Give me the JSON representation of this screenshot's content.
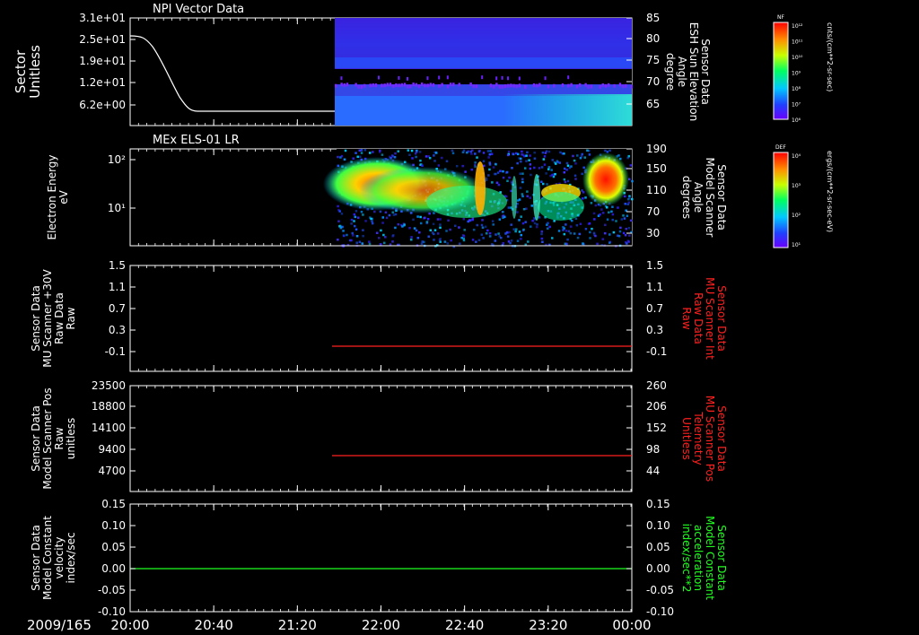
{
  "date_label": "2009/165",
  "time_ticks": [
    "20:00",
    "20:40",
    "21:20",
    "22:00",
    "22:40",
    "23:20",
    "00:00"
  ],
  "colorbars": [
    {
      "tag": "NF",
      "top_label": "10¹²",
      "tick_labels": [
        "10¹²",
        "10¹¹",
        "10¹⁰",
        "10⁹",
        "10⁸",
        "10⁷",
        "10⁶"
      ],
      "unit": "cnts/(cm**2-sr-sec)"
    },
    {
      "tag": "DEF",
      "tick_labels": [
        "10⁴",
        "10³",
        "10²",
        "10¹"
      ],
      "unit": "ergs/(cm**2-sr-sec-eV)"
    }
  ],
  "panels": [
    {
      "title": "NPI Vector Data",
      "left_label": [
        "Sector",
        "Unitless"
      ],
      "left_ticks": [
        "3.1e+01",
        "2.5e+01",
        "1.9e+01",
        "1.2e+01",
        "6.2e+00"
      ],
      "right_label": [
        "Sensor Data",
        "ESH Sun Elevation",
        "Angle",
        "degree"
      ],
      "right_ticks": [
        "85",
        "80",
        "75",
        "70",
        "65"
      ],
      "right_label_color": "#ffffff"
    },
    {
      "title": "MEx ELS-01 LR",
      "left_label": [
        "Electron Energy",
        "eV"
      ],
      "left_ticks": [
        "10²",
        "10¹"
      ],
      "right_label": [
        "Sensor Data",
        "Model Scanner",
        "Angle",
        "degrees"
      ],
      "right_ticks": [
        "190",
        "150",
        "110",
        "70",
        "30"
      ],
      "right_label_color": "#ffffff"
    },
    {
      "left_label": [
        "Sensor Data",
        "MU Scanner +30V",
        "Raw Data",
        "Raw"
      ],
      "left_ticks": [
        "1.5",
        "1.1",
        "0.7",
        "0.3",
        "-0.1"
      ],
      "right_label": [
        "Sensor Data",
        "MU Scanner Int",
        "Raw Data",
        "Raw"
      ],
      "right_ticks": [
        "1.5",
        "1.1",
        "0.7",
        "0.3",
        "-0.1"
      ],
      "right_label_color": "#ff2020"
    },
    {
      "left_label": [
        "Sensor Data",
        "Model Scanner Pos",
        "Raw",
        "unitless"
      ],
      "left_ticks": [
        "23500",
        "18800",
        "14100",
        "9400",
        "4700"
      ],
      "right_label": [
        "Sensor Data",
        "MU Scanner Pos",
        "Telemetry",
        "Unitless"
      ],
      "right_ticks": [
        "260",
        "206",
        "152",
        "98",
        "44"
      ],
      "right_label_color": "#ff2020"
    },
    {
      "left_label": [
        "Sensor Data",
        "Model Constant",
        "velocity",
        "index/sec"
      ],
      "left_ticks": [
        "0.15",
        "0.10",
        "0.05",
        "0.00",
        "-0.05",
        "-0.10"
      ],
      "right_label": [
        "Sensor Data",
        "Model Constant",
        "acceleration",
        "index/sec**2"
      ],
      "right_ticks": [
        "0.15",
        "0.10",
        "0.05",
        "0.00",
        "-0.05",
        "-0.10"
      ],
      "right_label_color": "#20ff20"
    }
  ],
  "chart_data": [
    {
      "type": "line",
      "title": "NPI Vector Data",
      "ylabel": "Sector Unitless",
      "x": [
        "20:00",
        "20:10",
        "20:20",
        "20:30",
        "20:40",
        "21:20",
        "22:00",
        "00:00"
      ],
      "series": [
        {
          "values": [
            26.5,
            25,
            16,
            8.5,
            5,
            5,
            5,
            5
          ]
        }
      ],
      "ylim": [
        0,
        31
      ]
    },
    {
      "type": "heatmap",
      "title": "MEx ELS-01 LR",
      "ylabel": "Electron Energy eV",
      "x_start": "21:35",
      "x_end": "00:00",
      "yscale": "log",
      "colorbar": "DEF"
    },
    {
      "type": "line",
      "ylabel": "MU Scanner Int Raw Data Raw",
      "series": [
        {
          "values": [
            0
          ]
        }
      ],
      "x_start": "21:34",
      "x_end": "00:00",
      "ylim": [
        -0.1,
        1.5
      ]
    },
    {
      "type": "line",
      "ylabel": "MU Scanner Pos Telemetry Unitless",
      "series": [
        {
          "values": [
            98
          ]
        }
      ],
      "x_start": "21:34",
      "x_end": "00:00",
      "ylim": [
        44,
        260
      ]
    },
    {
      "type": "line",
      "ylabel": "Model Constant acceleration index/sec**2",
      "series": [
        {
          "values": [
            0.0
          ]
        }
      ],
      "x_start": "20:00",
      "x_end": "00:00",
      "ylim": [
        -0.1,
        0.15
      ]
    }
  ]
}
